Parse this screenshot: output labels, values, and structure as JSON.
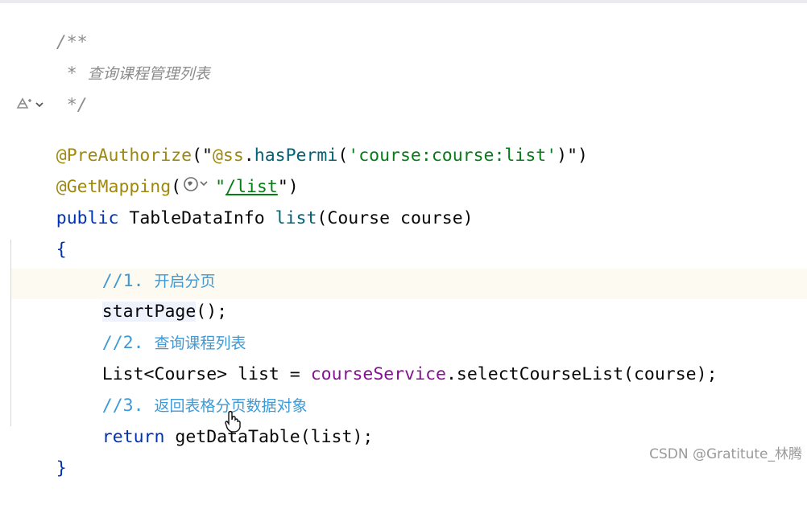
{
  "editor": {
    "doc_open": "/**",
    "doc_star": " * ",
    "doc_text": "查询课程管理列表",
    "doc_close": " */",
    "anno1_name": "@PreAuthorize",
    "anno1_open": "(\"",
    "anno1_ss": "@ss",
    "anno1_dot": ".",
    "anno1_method": "hasPermi",
    "anno1_paren": "(",
    "anno1_arg": "'course:course:list'",
    "anno1_close": ")\")",
    "anno2_name": "@GetMapping",
    "anno2_open": "(",
    "anno2_quote_open": "\"",
    "anno2_path": "/list",
    "anno2_quote_close": "\")",
    "sig_kw": "public",
    "sig_type": "TableDataInfo",
    "sig_name": "list",
    "sig_params_open": "(",
    "sig_param_type": "Course",
    "sig_param_name": "course",
    "sig_params_close": ")",
    "brace_open": "{",
    "c1_prefix": "//1. ",
    "c1_text": "开启分页",
    "l_start_name": "startPage",
    "l_start_rest": "();",
    "c2_prefix": "//2. ",
    "c2_text": "查询课程列表",
    "l_list_type": "List<Course>",
    "l_list_mid": " list = ",
    "l_list_service": "courseService",
    "l_list_call": ".selectCourseList(course);",
    "c3_prefix": "//3. ",
    "c3_text": "返回表格分页数据对象",
    "l_ret_kw": "return",
    "l_ret_call": " getDataTable(list);",
    "brace_close": "}"
  },
  "icons": {
    "gutter": "ai-assistant-icon",
    "globe": "globe-endpoint-icon",
    "cursor": "hand-pointer-cursor"
  },
  "watermark": "CSDN @Gratitute_林腾",
  "colors": {
    "annotation": "#9e880d",
    "string": "#067d17",
    "keyword": "#0033b3",
    "method": "#00627a",
    "comment": "#3d9ad6",
    "doc_comment": "#8c8c8c",
    "field": "#871094",
    "current_line": "#fdfbf1"
  }
}
